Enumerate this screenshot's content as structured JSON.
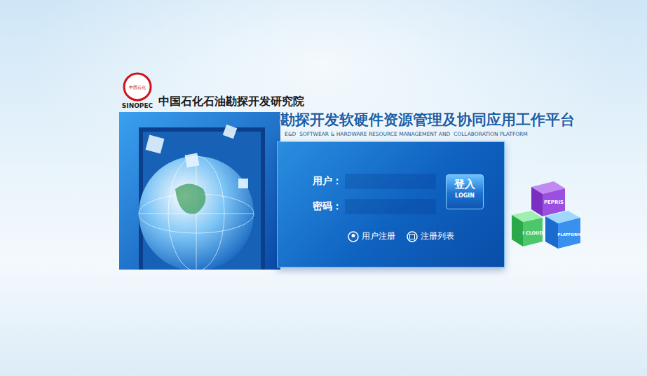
{
  "organization": {
    "logo_cn": "中国石化",
    "logo_en": "SINOPEC",
    "name": "中国石化石油勘探开发研究院"
  },
  "title": "勘探开发软硬件资源管理及协同应用工作平台",
  "subtitle": "E&D  SOFTWEAR & HARDWARE RESOURCE MANAGEMENT AND  COLLABORATION PLATFORM",
  "form": {
    "fields": [
      {
        "label": "用户："
      },
      {
        "label": "密码："
      }
    ]
  },
  "login_button": {
    "label": "登入",
    "sublabel": "LOGIN"
  },
  "links": [
    {
      "label": "用户注册"
    },
    {
      "label": "注册列表"
    }
  ],
  "cubes": [
    "PEPRIS",
    "I CLOUD",
    "PLATFORM"
  ]
}
